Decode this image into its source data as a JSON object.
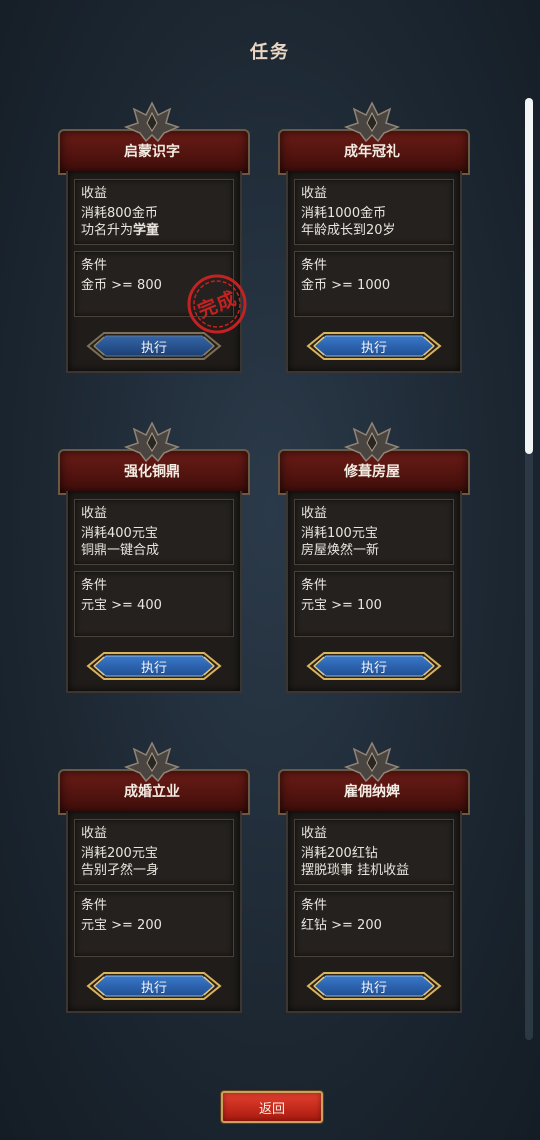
{
  "header": {
    "title": "任务"
  },
  "colors": {
    "accent_red": "#c32222",
    "button_blue": "#2a5ea8",
    "frame_gold": "#c9a15e"
  },
  "quests": [
    {
      "title": "启蒙识字",
      "reward_label": "收益",
      "reward_line1": "消耗800金币",
      "reward_line2_prefix": "功名升为",
      "reward_line2_highlight": "学童",
      "condition_label": "条件",
      "condition": "金币 >= 800",
      "action_label": "执行",
      "completed": true,
      "stamp_text": "完成"
    },
    {
      "title": "成年冠礼",
      "reward_label": "收益",
      "reward_line1": "消耗1000金币",
      "reward_line2_prefix": "年龄成长到20岁",
      "condition_label": "条件",
      "condition": "金币 >= 1000",
      "action_label": "执行",
      "completed": false
    },
    {
      "title": "强化铜鼎",
      "reward_label": "收益",
      "reward_line1": "消耗400元宝",
      "reward_line2_prefix": "铜鼎一键合成",
      "condition_label": "条件",
      "condition": "元宝 >= 400",
      "action_label": "执行",
      "completed": false
    },
    {
      "title": "修葺房屋",
      "reward_label": "收益",
      "reward_line1": "消耗100元宝",
      "reward_line2_prefix": "房屋焕然一新",
      "condition_label": "条件",
      "condition": "元宝 >= 100",
      "action_label": "执行",
      "completed": false
    },
    {
      "title": "成婚立业",
      "reward_label": "收益",
      "reward_line1": "消耗200元宝",
      "reward_line2_prefix": "告别孑然一身",
      "condition_label": "条件",
      "condition": "元宝 >= 200",
      "action_label": "执行",
      "completed": false
    },
    {
      "title": "雇佣纳婢",
      "reward_label": "收益",
      "reward_line1": "消耗200红钻",
      "reward_line2_prefix": "摆脱琐事 挂机收益",
      "condition_label": "条件",
      "condition": "红钻 >= 200",
      "action_label": "执行",
      "completed": false
    }
  ],
  "footer": {
    "return_label": "返回"
  }
}
